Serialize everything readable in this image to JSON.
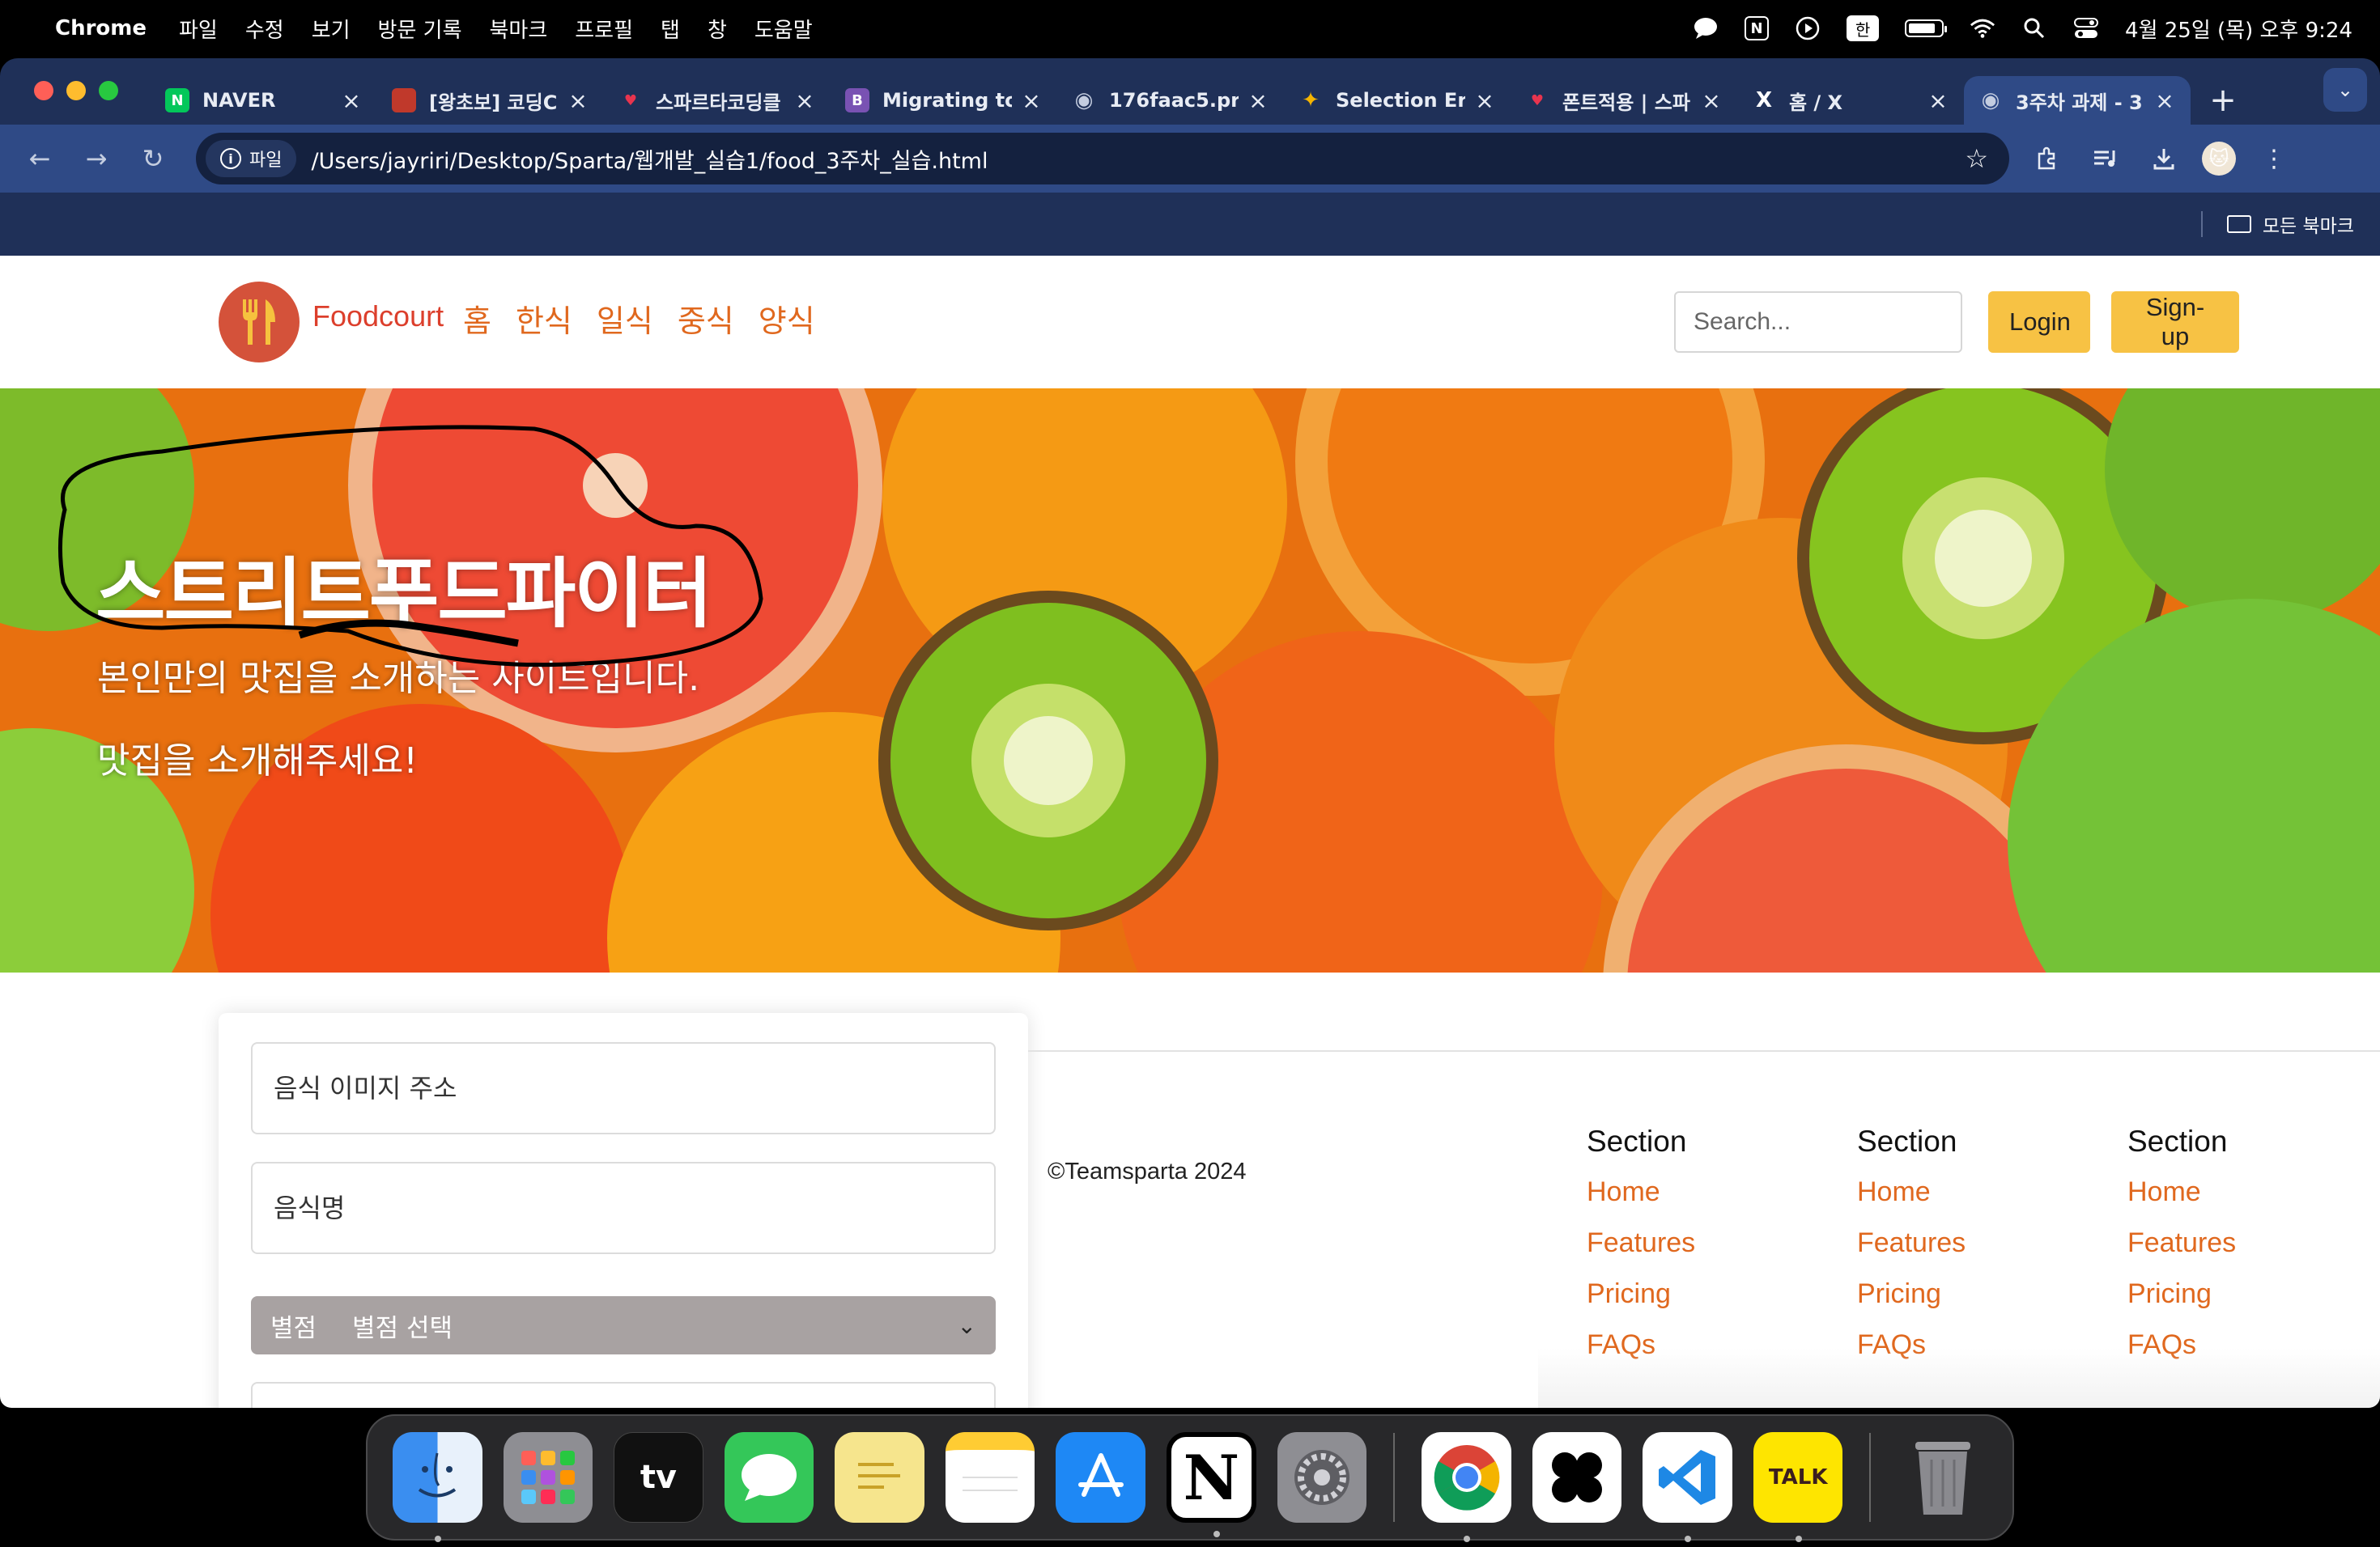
{
  "menubar": {
    "app_name": "Chrome",
    "items": [
      "파일",
      "수정",
      "보기",
      "방문 기록",
      "북마크",
      "프로필",
      "탭",
      "창",
      "도움말"
    ],
    "input_source": "한",
    "datetime": "4월 25일 (목) 오후 9:24"
  },
  "tabs": [
    {
      "title": "NAVER",
      "favicon": "N",
      "color": "#03c75a"
    },
    {
      "title": "[왕초보] 코딩C",
      "favicon": "",
      "color": "#c0392b"
    },
    {
      "title": "스파르타코딩클",
      "favicon": "♥",
      "color": "#e8344e"
    },
    {
      "title": "Migrating to",
      "favicon": "B",
      "color": "#7952b3"
    },
    {
      "title": "176faac5.pr",
      "favicon": "◉",
      "color": "#5f6b85"
    },
    {
      "title": "Selection Er",
      "favicon": "✦",
      "color": "#2b7de9"
    },
    {
      "title": "폰트적용 | 스파",
      "favicon": "♥",
      "color": "#e8344e"
    },
    {
      "title": "홈 / X",
      "favicon": "X",
      "color": "#000000"
    },
    {
      "title": "3주차 과제 - 3",
      "favicon": "◉",
      "color": "#5f6b85"
    }
  ],
  "toolbar": {
    "chip_label": "파일",
    "url": "/Users/jayriri/Desktop/Sparta/웹개발_실습1/food_3주차_실습.html"
  },
  "bookmarks": {
    "all_label": "모든 북마크"
  },
  "site": {
    "brand": "Foodcourt",
    "nav": [
      "홈",
      "한식",
      "일식",
      "중식",
      "양식"
    ],
    "search_placeholder": "Search...",
    "login": "Login",
    "signup": "Sign-up"
  },
  "hero": {
    "title": "스트리트푸드파이터",
    "subtitle1": "본인만의 맛집을 소개하는 사이트입니다.",
    "subtitle2": "맛집을 소개해주세요!"
  },
  "form": {
    "image_placeholder": "음식 이미지 주소",
    "name_placeholder": "음식명",
    "rating_label": "별점",
    "rating_select": "별점 선택"
  },
  "footer": {
    "copyright": "©Teamsparta 2024",
    "columns": [
      {
        "title": "Section",
        "links": [
          "Home",
          "Features",
          "Pricing",
          "FAQs"
        ]
      },
      {
        "title": "Section",
        "links": [
          "Home",
          "Features",
          "Pricing",
          "FAQs"
        ]
      },
      {
        "title": "Section",
        "links": [
          "Home",
          "Features",
          "Pricing",
          "FAQs"
        ]
      }
    ]
  },
  "dock": {
    "apps": [
      "finder-icon",
      "launchpad-icon",
      "apple-tv-icon",
      "messages-icon",
      "stickies-icon",
      "notes-icon",
      "app-store-icon",
      "notion-icon",
      "system-settings-icon",
      "chrome-icon",
      "capcut-icon",
      "vscode-icon",
      "kakaotalk-icon",
      "trash-icon"
    ],
    "apple_tv_label": "tv",
    "notion_label": "N",
    "kakaotalk_label": "TALK"
  }
}
